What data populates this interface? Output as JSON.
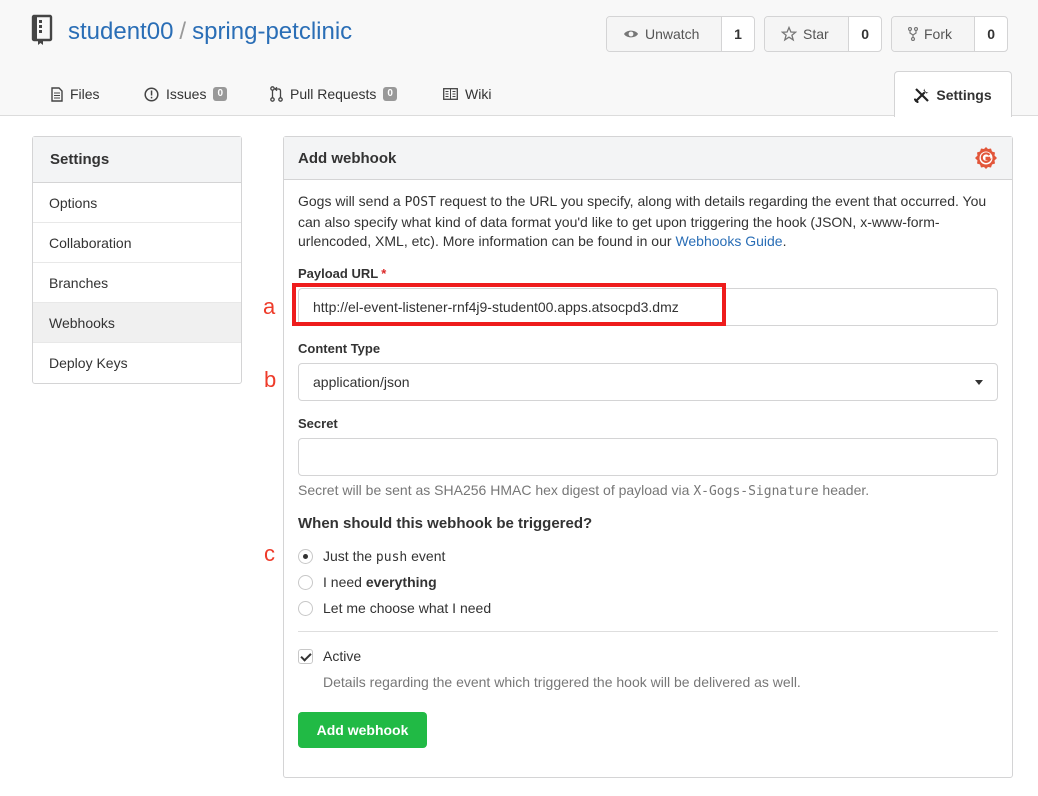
{
  "header": {
    "owner": "student00",
    "separator": "/",
    "repo": "spring-petclinic",
    "watch": {
      "label": "Unwatch",
      "count": "1"
    },
    "star": {
      "label": "Star",
      "count": "0"
    },
    "fork": {
      "label": "Fork",
      "count": "0"
    }
  },
  "tabs": {
    "files": {
      "label": "Files"
    },
    "issues": {
      "label": "Issues",
      "badge": "0"
    },
    "pulls": {
      "label": "Pull Requests",
      "badge": "0"
    },
    "wiki": {
      "label": "Wiki"
    },
    "settings": {
      "label": "Settings"
    }
  },
  "sidebar": {
    "title": "Settings",
    "items": [
      {
        "label": "Options"
      },
      {
        "label": "Collaboration"
      },
      {
        "label": "Branches"
      },
      {
        "label": "Webhooks",
        "active": true
      },
      {
        "label": "Deploy Keys"
      }
    ]
  },
  "form": {
    "title": "Add webhook",
    "description_pre": "Gogs will send a ",
    "description_method": "POST",
    "description_post": " request to the URL you specify, along with details regarding the event that occurred. You can also specify what kind of data format you'd like to get upon triggering the hook (JSON, x-www-form-urlencoded, XML, etc). More information can be found in our ",
    "description_link": "Webhooks Guide",
    "description_end": ".",
    "payload_url_label": "Payload URL",
    "payload_url_required": "*",
    "payload_url_value": "http://el-event-listener-rnf4j9-student00.apps.atsocpd3.dmz",
    "content_type_label": "Content Type",
    "content_type_value": "application/json",
    "secret_label": "Secret",
    "secret_value": "",
    "secret_hint_pre": "Secret will be sent as SHA256 HMAC hex digest of payload via ",
    "secret_hint_code": "X-Gogs-Signature",
    "secret_hint_post": " header.",
    "trigger_question": "When should this webhook be triggered?",
    "trigger_push_pre": "Just the ",
    "trigger_push_code": "push",
    "trigger_push_post": " event",
    "trigger_all_pre": "I need ",
    "trigger_all_bold": "everything",
    "trigger_choose": "Let me choose what I need",
    "trigger_selected": "push",
    "active_label": "Active",
    "active_checked": true,
    "active_hint": "Details regarding the event which triggered the hook will be delivered as well.",
    "submit_label": "Add webhook"
  },
  "annotations": {
    "a": "a",
    "b": "b",
    "c": "c"
  },
  "colors": {
    "accent_blue": "#2a6eb6",
    "submit_green": "#21ba45",
    "annotation_red": "#ee1c1c",
    "gogs_logo": "#e2563a"
  }
}
